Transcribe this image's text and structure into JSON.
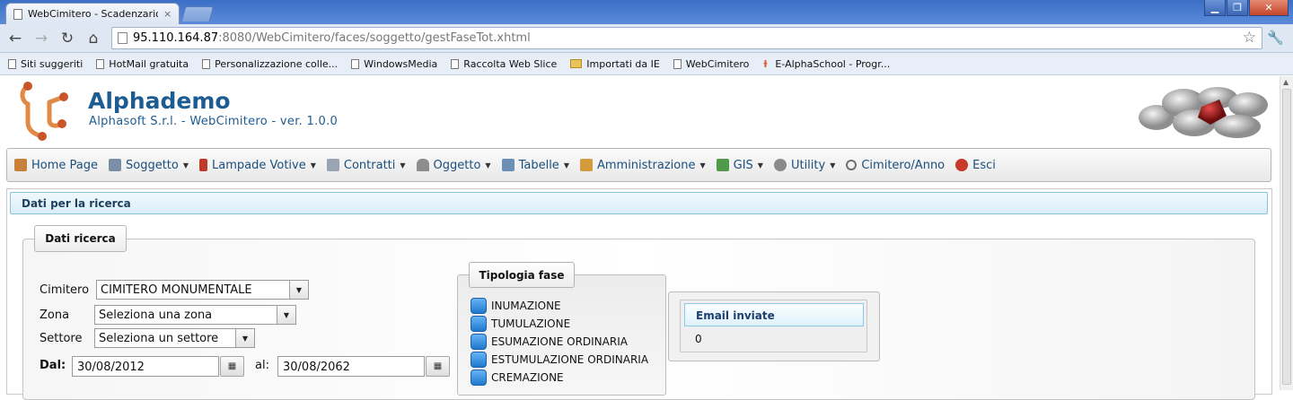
{
  "browser": {
    "tab_title": "WebCimitero - Scadenzario F",
    "tab_close": "×",
    "url_host": "95.110.164.87",
    "url_path": ":8080/WebCimitero/faces/soggetto/gestFaseTot.xhtml",
    "bookmarks": [
      {
        "label": "Siti suggeriti",
        "icon": "page-icon"
      },
      {
        "label": "HotMail gratuita",
        "icon": "page-icon"
      },
      {
        "label": "Personalizzazione colle...",
        "icon": "page-icon"
      },
      {
        "label": "WindowsMedia",
        "icon": "page-icon"
      },
      {
        "label": "Raccolta Web Slice",
        "icon": "page-icon"
      },
      {
        "label": "Importati da IE",
        "icon": "folder-icon"
      },
      {
        "label": "WebCimitero",
        "icon": "page-icon"
      },
      {
        "label": "E-AlphaSchool - Progr...",
        "icon": "alpha-icon"
      }
    ]
  },
  "header": {
    "brand": "Alphademo",
    "subtitle": "Alphasoft S.r.l. - WebCimitero - ver. 1.0.0"
  },
  "menu": {
    "items": [
      {
        "label": "Home Page",
        "icon": "home-icon",
        "color": "#c9803a",
        "dropdown": false
      },
      {
        "label": "Soggetto",
        "icon": "person-icon",
        "color": "#7a8fa6",
        "dropdown": true
      },
      {
        "label": "Lampade Votive",
        "icon": "lamp-icon",
        "color": "#c0392b",
        "dropdown": true
      },
      {
        "label": "Contratti",
        "icon": "contract-icon",
        "color": "#9aa5b3",
        "dropdown": true
      },
      {
        "label": "Oggetto",
        "icon": "tomb-icon",
        "color": "#8d8d8d",
        "dropdown": true
      },
      {
        "label": "Tabelle",
        "icon": "table-icon",
        "color": "#6c8fb7",
        "dropdown": true
      },
      {
        "label": "Amministrazione",
        "icon": "admin-icon",
        "color": "#d39b3a",
        "dropdown": true
      },
      {
        "label": "GIS",
        "icon": "map-icon",
        "color": "#4f9b4a",
        "dropdown": true
      },
      {
        "label": "Utility",
        "icon": "gear-icon",
        "color": "#8a8a8a",
        "dropdown": true
      },
      {
        "label": "Cimitero/Anno",
        "icon": "refresh-icon",
        "color": "#6f6f6f",
        "dropdown": false
      },
      {
        "label": "Esci",
        "icon": "exit-icon",
        "color": "#c8382b",
        "dropdown": false
      }
    ]
  },
  "panel": {
    "title": "Dati per la ricerca"
  },
  "search": {
    "legend": "Dati ricerca",
    "cimitero_label": "Cimitero",
    "cimitero_value": "CIMITERO MONUMENTALE",
    "zona_label": "Zona",
    "zona_value": "Seleziona una zona",
    "settore_label": "Settore",
    "settore_value": "Seleziona un settore",
    "dal_label": "Dal:",
    "dal_value": "30/08/2012",
    "al_label": "al:",
    "al_value": "30/08/2062"
  },
  "tipologia": {
    "legend": "Tipologia fase",
    "options": [
      "INUMAZIONE",
      "TUMULAZIONE",
      "ESUMAZIONE ORDINARIA",
      "ESTUMULAZIONE ORDINARIA",
      "CREMAZIONE"
    ]
  },
  "email": {
    "header": "Email inviate",
    "count": "0"
  }
}
